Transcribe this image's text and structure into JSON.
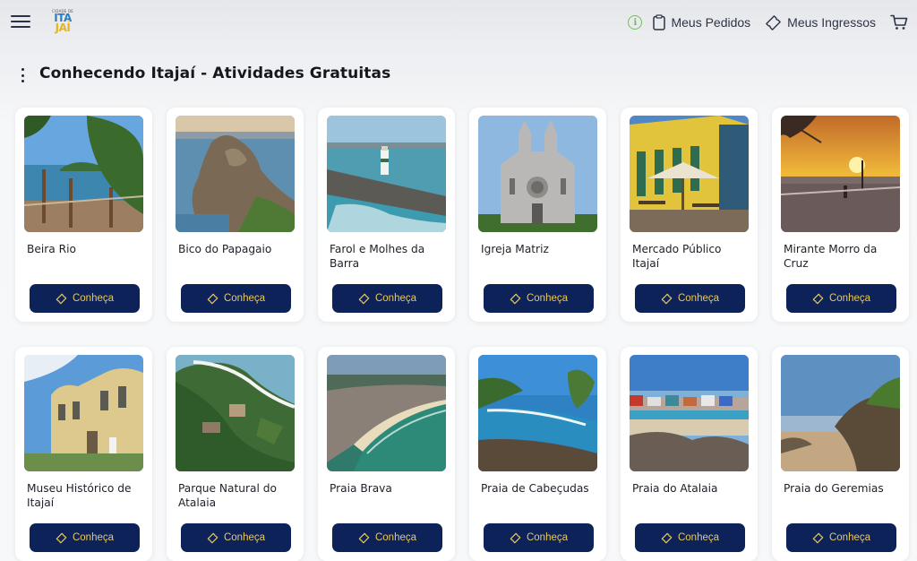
{
  "header": {
    "logo_small": "CIDADE DE",
    "logo_line1": "ITA",
    "logo_line2": "JAÍ",
    "info_icon": "info-icon",
    "orders_label": "Meus Pedidos",
    "tickets_label": "Meus Ingressos",
    "cart_icon": "cart-icon"
  },
  "page": {
    "title": "Conhecendo Itajaí - Atividades Gratuitas"
  },
  "cards": [
    {
      "name": "Beira Rio",
      "button": "Conheça",
      "image": "river-beach-photo"
    },
    {
      "name": "Bico do Papagaio",
      "button": "Conheça",
      "image": "rock-sea-photo"
    },
    {
      "name": "Farol e Molhes da Barra",
      "button": "Conheça",
      "image": "lighthouse-pier-photo"
    },
    {
      "name": "Igreja Matriz",
      "button": "Conheça",
      "image": "church-photo"
    },
    {
      "name": "Mercado Público Itajaí",
      "button": "Conheça",
      "image": "market-building-photo"
    },
    {
      "name": "Mirante Morro da Cruz",
      "button": "Conheça",
      "image": "sunset-viewpoint-photo"
    },
    {
      "name": "Museu Histórico de Itajaí",
      "button": "Conheça",
      "image": "museum-building-photo"
    },
    {
      "name": "Parque Natural do Atalaia",
      "button": "Conheça",
      "image": "park-aerial-photo"
    },
    {
      "name": "Praia Brava",
      "button": "Conheça",
      "image": "beach-aerial-photo"
    },
    {
      "name": "Praia de Cabeçudas",
      "button": "Conheça",
      "image": "cove-beach-photo"
    },
    {
      "name": "Praia do Atalaia",
      "button": "Conheça",
      "image": "port-beach-photo"
    },
    {
      "name": "Praia do Geremias",
      "button": "Conheça",
      "image": "rocky-beach-photo"
    }
  ],
  "colors": {
    "button_bg": "#0d2259",
    "button_text": "#e9c85a",
    "info_green": "#6fbf58"
  }
}
